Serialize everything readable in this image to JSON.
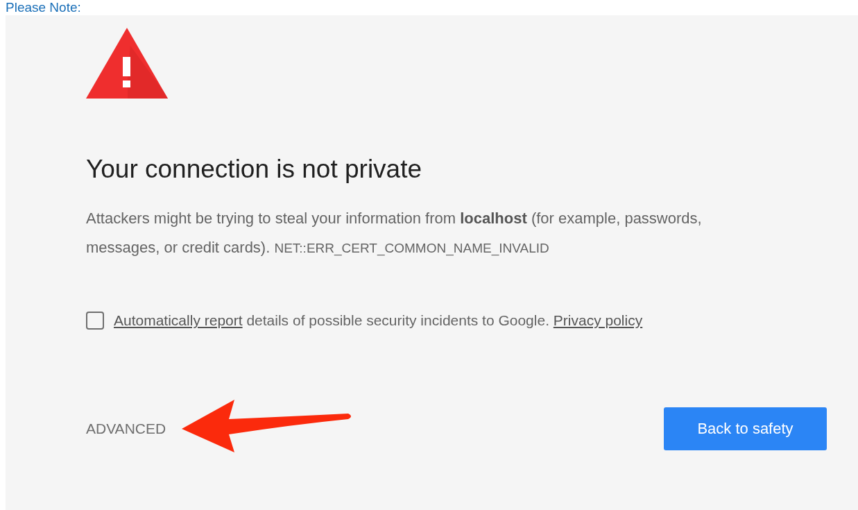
{
  "note_heading": "Please Note:",
  "interstitial": {
    "title": "Your connection is not private",
    "description": "Attackers might be trying to steal your information from **localhost** (for example, passwords, messages, or credit cards).",
    "error_code": "NET::ERR_CERT_COMMON_NAME_INVALID",
    "report_option": {
      "checked": false,
      "link": "Automatically report",
      "text": " details of possible security incidents to Google. ",
      "policy_link": "Privacy policy"
    },
    "advanced_link": "ADVANCED",
    "primary_button": "Back to safety"
  }
}
